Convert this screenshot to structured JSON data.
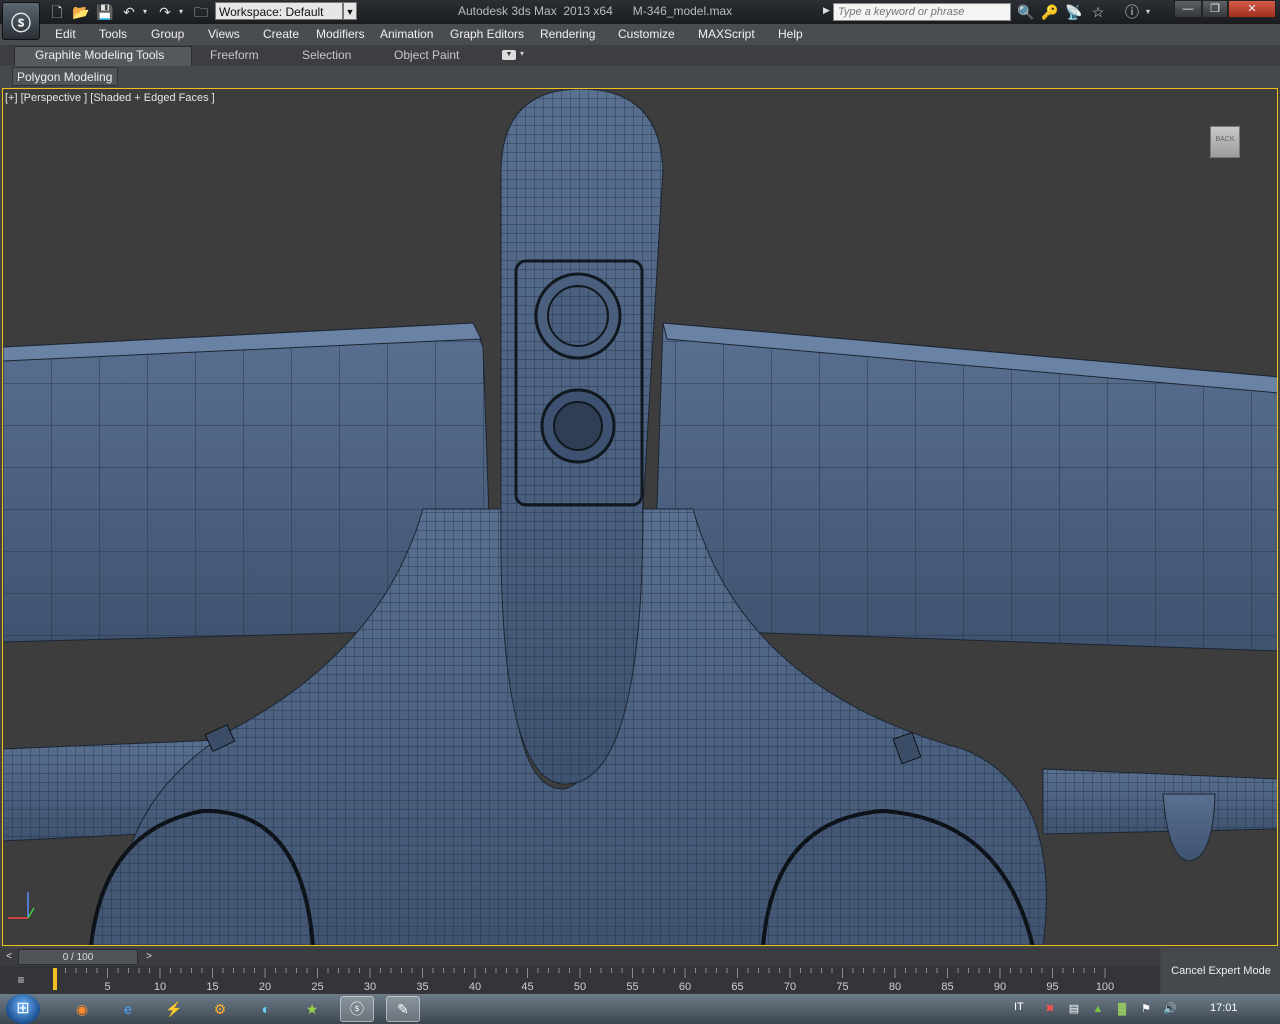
{
  "title_bar": {
    "window_title": "Autodesk 3ds Max  2013 x64      M-346_model.max",
    "workspace": "Workspace: Default",
    "search_placeholder": "Type a keyword or phrase"
  },
  "menu": [
    "Edit",
    "Tools",
    "Group",
    "Views",
    "Create",
    "Modifiers",
    "Animation",
    "Graph Editors",
    "Rendering",
    "Customize",
    "MAXScript",
    "Help"
  ],
  "ribbon": {
    "tabs": [
      "Graphite Modeling Tools",
      "Freeform",
      "Selection",
      "Object Paint"
    ],
    "panel_button": "Polygon Modeling"
  },
  "viewport": {
    "label": "[+] [Perspective ] [Shaded + Edged Faces ]",
    "viewcube_face": "BACK"
  },
  "timeline": {
    "frame_indicator": "0 / 100",
    "ticks": [
      "5",
      "10",
      "15",
      "20",
      "25",
      "30",
      "35",
      "40",
      "45",
      "50",
      "55",
      "60",
      "65",
      "70",
      "75",
      "80",
      "85",
      "90",
      "95",
      "100"
    ]
  },
  "status": {
    "expert_button": "Cancel Expert Mode"
  },
  "taskbar": {
    "language": "IT",
    "clock": "17:01"
  },
  "colors": {
    "mesh_fill": "#4f6585",
    "viewport_bg": "#3d3d3d",
    "active_border": "#f0c020"
  }
}
